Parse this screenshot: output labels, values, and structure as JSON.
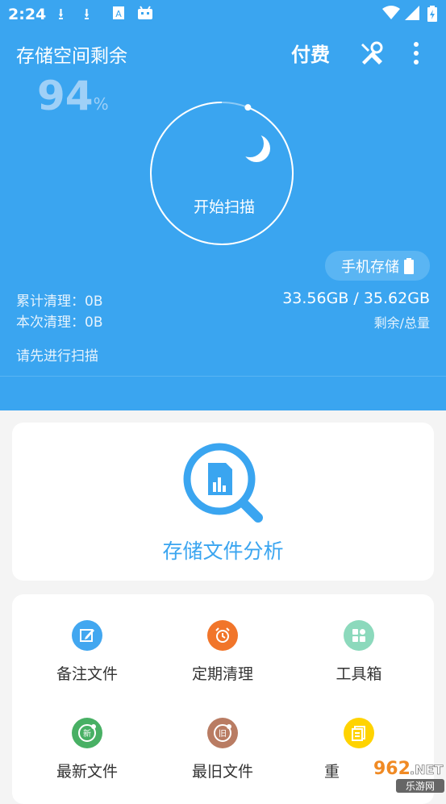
{
  "status_bar": {
    "time": "2:24",
    "icons": [
      "download-icon",
      "download-icon",
      "text-app-icon",
      "android-icon",
      "wifi-icon",
      "signal-icon",
      "battery-charging-icon"
    ]
  },
  "header": {
    "title": "存储空间剩余",
    "pay_label": "付费",
    "tools_icon": "tools-icon",
    "more_icon": "more-vertical-icon"
  },
  "storage": {
    "percent": "94",
    "percent_sign": "%",
    "remaining_fraction": 0.94,
    "start_scan_label": "开始扫描",
    "phone_storage_label": "手机存储",
    "total_cleaned": "累计清理：0B",
    "this_cleaned": "本次清理：0B",
    "size_text": "33.56GB / 35.62GB",
    "size_label": "剩余/总量",
    "hint": "请先进行扫描"
  },
  "analysis": {
    "label": "存储文件分析",
    "icon": "storage-analysis-icon"
  },
  "tools": [
    {
      "label": "备注文件",
      "icon": "edit-note-icon",
      "color": "#42a7f0"
    },
    {
      "label": "定期清理",
      "icon": "alarm-clock-icon",
      "color": "#f1752a"
    },
    {
      "label": "工具箱",
      "icon": "toolbox-icon",
      "color": "#8cd9bc"
    },
    {
      "label": "最新文件",
      "icon": "new-file-icon",
      "color": "#48b064"
    },
    {
      "label": "最旧文件",
      "icon": "old-file-icon",
      "color": "#b97c63"
    },
    {
      "label": "重",
      "icon": "duplicate-file-icon",
      "color": "#ffd300"
    }
  ],
  "colors": {
    "primary": "#3aa5f0",
    "background": "#f4f4f4"
  },
  "watermark": {
    "text": "962.NET",
    "subtext": "乐游网"
  }
}
